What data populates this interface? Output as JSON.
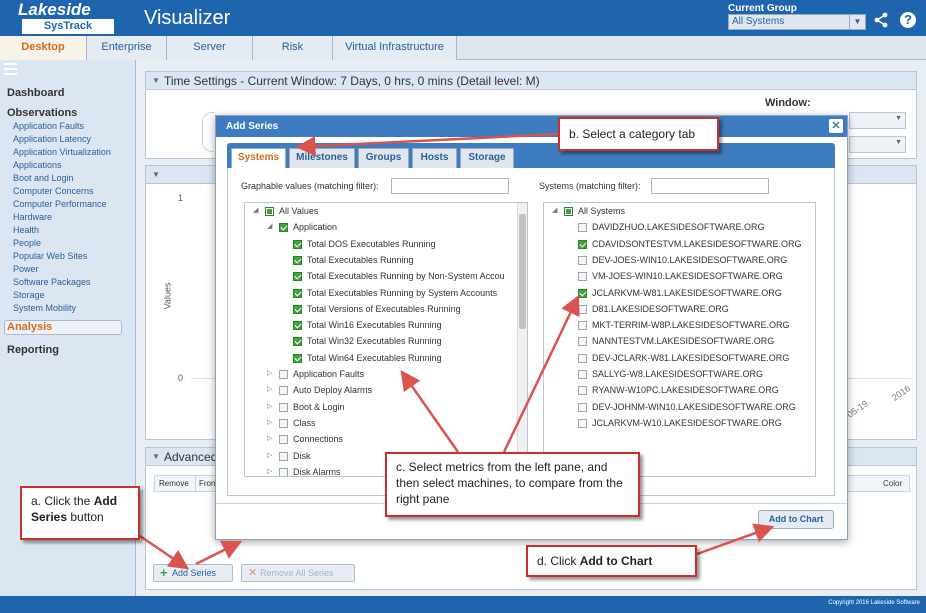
{
  "header": {
    "logo_main": "Lakeside",
    "logo_sub": "SysTrack",
    "app_title": "Visualizer",
    "current_group_label": "Current Group",
    "current_group_value": "All Systems"
  },
  "tabs": [
    "Desktop",
    "Enterprise",
    "Server",
    "Risk",
    "Virtual Infrastructure"
  ],
  "sidebar": {
    "dashboard": "Dashboard",
    "observations": "Observations",
    "items": [
      "Application Faults",
      "Application Latency",
      "Application Virtualization",
      "Applications",
      "Boot and Login",
      "Computer Concerns",
      "Computer Performance",
      "Hardware",
      "Health",
      "People",
      "Popular Web Sites",
      "Power",
      "Software Packages",
      "Storage",
      "System Mobility"
    ],
    "analysis": "Analysis",
    "reporting": "Reporting"
  },
  "main": {
    "time_settings": "Time Settings - Current Window: 7 Days, 0 hrs, 0 mins (Detail level: M)",
    "window_label": "Window:",
    "chart_y_top": "1",
    "chart_y_zero": "0",
    "chart_ylabel": "Values",
    "chart_x_tick_1": "2016",
    "chart_x_tick_2": "05-19",
    "advanced": "Advanced",
    "col_remove": "Remove",
    "col_front": "Front",
    "col_color": "Color",
    "add_series": "Add Series",
    "remove_all_series": "Remove All Series"
  },
  "modal": {
    "title": "Add Series",
    "tabs": [
      "Systems",
      "Milestones",
      "Groups",
      "Hosts",
      "Storage"
    ],
    "left_filter_label": "Graphable values (matching filter):",
    "right_filter_label": "Systems (matching filter):",
    "left_tree": [
      {
        "label": "All Values",
        "state": "partial",
        "level": 0,
        "expand": "open"
      },
      {
        "label": "Application",
        "state": "checked",
        "level": 1,
        "expand": "open"
      },
      {
        "label": "Total DOS Executables Running",
        "state": "checked",
        "level": 2,
        "expand": ""
      },
      {
        "label": "Total Executables Running",
        "state": "checked",
        "level": 2,
        "expand": ""
      },
      {
        "label": "Total Executables Running by Non-System Accou",
        "state": "checked",
        "level": 2,
        "expand": ""
      },
      {
        "label": "Total Executables Running by System Accounts",
        "state": "checked",
        "level": 2,
        "expand": ""
      },
      {
        "label": "Total Versions of Executables Running",
        "state": "checked",
        "level": 2,
        "expand": ""
      },
      {
        "label": "Total Win16 Executables Running",
        "state": "checked",
        "level": 2,
        "expand": ""
      },
      {
        "label": "Total Win32 Executables Running",
        "state": "checked",
        "level": 2,
        "expand": ""
      },
      {
        "label": "Total Win64 Executables Running",
        "state": "checked",
        "level": 2,
        "expand": ""
      },
      {
        "label": "Application Faults",
        "state": "",
        "level": 1,
        "expand": "closed"
      },
      {
        "label": "Auto Deploy Alarms",
        "state": "",
        "level": 1,
        "expand": "closed"
      },
      {
        "label": "Boot & Login",
        "state": "",
        "level": 1,
        "expand": "closed"
      },
      {
        "label": "Class",
        "state": "",
        "level": 1,
        "expand": "closed"
      },
      {
        "label": "Connections",
        "state": "",
        "level": 1,
        "expand": "closed"
      },
      {
        "label": "Disk",
        "state": "",
        "level": 1,
        "expand": "closed"
      },
      {
        "label": "Disk Alarms",
        "state": "",
        "level": 1,
        "expand": "closed"
      }
    ],
    "right_tree": [
      {
        "label": "All Systems",
        "state": "partial",
        "level": 0,
        "expand": "open"
      },
      {
        "label": "DAVIDZHUO.LAKESIDESOFTWARE.ORG",
        "state": "",
        "level": 1,
        "expand": ""
      },
      {
        "label": "CDAVIDSONTESTVM.LAKESIDESOFTWARE.ORG",
        "state": "checked",
        "level": 1,
        "expand": ""
      },
      {
        "label": "DEV-JOES-WIN10.LAKESIDESOFTWARE.ORG",
        "state": "",
        "level": 1,
        "expand": ""
      },
      {
        "label": "VM-JOES-WIN10.LAKESIDESOFTWARE.ORG",
        "state": "",
        "level": 1,
        "expand": ""
      },
      {
        "label": "JCLARKVM-W81.LAKESIDESOFTWARE.ORG",
        "state": "checked",
        "level": 1,
        "expand": ""
      },
      {
        "label": "D81.LAKESIDESOFTWARE.ORG",
        "state": "",
        "level": 1,
        "expand": ""
      },
      {
        "label": "MKT-TERRIM-W8P.LAKESIDESOFTWARE.ORG",
        "state": "",
        "level": 1,
        "expand": ""
      },
      {
        "label": "NANNTESTVM.LAKESIDESOFTWARE.ORG",
        "state": "",
        "level": 1,
        "expand": ""
      },
      {
        "label": "DEV-JCLARK-W81.LAKESIDESOFTWARE.ORG",
        "state": "",
        "level": 1,
        "expand": ""
      },
      {
        "label": "SALLYG-W8.LAKESIDESOFTWARE.ORG",
        "state": "",
        "level": 1,
        "expand": ""
      },
      {
        "label": "RYANW-W10PC.LAKESIDESOFTWARE.ORG",
        "state": "",
        "level": 1,
        "expand": ""
      },
      {
        "label": "DEV-JOHNM-WIN10.LAKESIDESOFTWARE.ORG",
        "state": "",
        "level": 1,
        "expand": ""
      },
      {
        "label": "JCLARKVM-W10.LAKESIDESOFTWARE.ORG",
        "state": "",
        "level": 1,
        "expand": ""
      }
    ],
    "add_to_chart": "Add to Chart"
  },
  "callouts": {
    "a_prefix": "a. Click the ",
    "a_bold": "Add Series",
    "a_suffix": " button",
    "b": "b. Select a category tab",
    "c": "c. Select metrics from the left pane, and then select machines, to compare from the right pane",
    "d_prefix": "d. Click ",
    "d_bold": "Add to Chart"
  },
  "footer": {
    "copyright": "Copyright 2016 Lakeside Software"
  },
  "colors": {
    "brand": "#1f65ae",
    "accent": "#d46a1c",
    "callout_border": "#c9302c",
    "checked": "#3fa43f"
  }
}
